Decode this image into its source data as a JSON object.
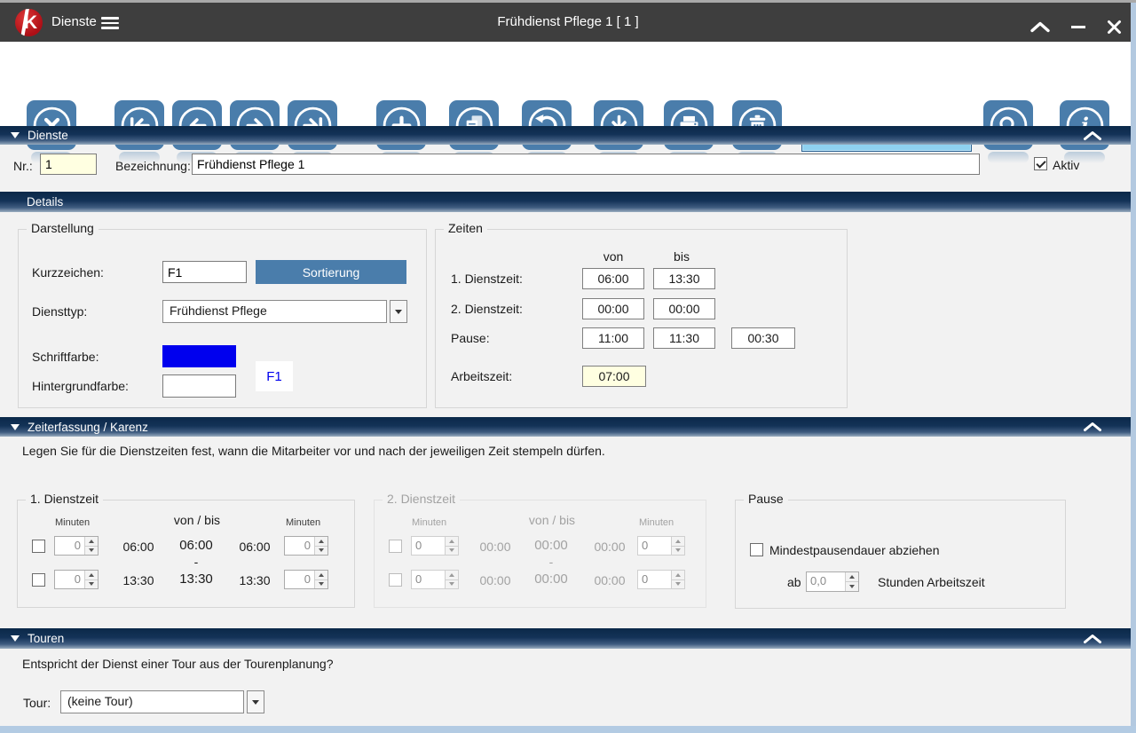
{
  "window": {
    "logo_letter": "K",
    "menu_label": "Dienste",
    "title": "Frühdienst Pflege 1  [ 1 ]"
  },
  "toolbar": {
    "search_value": "",
    "button_names": [
      "close",
      "first-record",
      "previous-record",
      "next-record",
      "last-record",
      "new-record",
      "copy-record",
      "undo",
      "save",
      "print",
      "delete",
      "search",
      "info"
    ]
  },
  "dienste": {
    "header": "Dienste",
    "nr_label": "Nr.:",
    "nr_value": "1",
    "bezeichnung_label": "Bezeichnung:",
    "bezeichnung_value": "Frühdienst Pflege 1",
    "aktiv_label": "Aktiv",
    "aktiv_checked": true
  },
  "details": {
    "header": "Details",
    "darstellung": {
      "title": "Darstellung",
      "kurzzeichen_label": "Kurzzeichen:",
      "kurzzeichen_value": "F1",
      "sortierung_button": "Sortierung",
      "diensttyp_label": "Diensttyp:",
      "diensttyp_value": "Frühdienst Pflege",
      "schriftfarbe_label": "Schriftfarbe:",
      "schriftfarbe_color": "#0000ee",
      "hintergrundfarbe_label": "Hintergrundfarbe:",
      "hintergrundfarbe_color": "#ffffff",
      "preview_text": "F1"
    },
    "zeiten": {
      "title": "Zeiten",
      "von_label": "von",
      "bis_label": "bis",
      "dienstzeit1_label": "1. Dienstzeit:",
      "dienstzeit1_von": "06:00",
      "dienstzeit1_bis": "13:30",
      "dienstzeit2_label": "2. Dienstzeit:",
      "dienstzeit2_von": "00:00",
      "dienstzeit2_bis": "00:00",
      "pause_label": "Pause:",
      "pause_von": "11:00",
      "pause_bis": "11:30",
      "pause_dauer": "00:30",
      "arbeitszeit_label": "Arbeitszeit:",
      "arbeitszeit_value": "07:00"
    }
  },
  "zeiterfassung": {
    "header": "Zeiterfassung / Karenz",
    "description": "Legen Sie für die Dienstzeiten fest, wann die Mitarbeiter vor und nach der jeweiligen Zeit stempeln dürfen.",
    "dienstzeit1": {
      "title": "1. Dienstzeit",
      "minuten_label": "Minuten",
      "vonbis_label": "von / bis",
      "trenner": "-",
      "row1": {
        "checked": false,
        "minuten_vor": "0",
        "zeit": "06:00",
        "zeit_mitte": "06:00",
        "zeit2": "06:00",
        "minuten_nach": "0"
      },
      "row2": {
        "checked": false,
        "minuten_vor": "0",
        "zeit": "13:30",
        "zeit_mitte": "13:30",
        "zeit2": "13:30",
        "minuten_nach": "0"
      }
    },
    "dienstzeit2": {
      "title": "2. Dienstzeit",
      "minuten_label": "Minuten",
      "vonbis_label": "von / bis",
      "trenner": "-",
      "row1": {
        "checked": false,
        "minuten_vor": "0",
        "zeit": "00:00",
        "zeit_mitte": "00:00",
        "zeit2": "00:00",
        "minuten_nach": "0"
      },
      "row2": {
        "checked": false,
        "minuten_vor": "0",
        "zeit": "00:00",
        "zeit_mitte": "00:00",
        "zeit2": "00:00",
        "minuten_nach": "0"
      }
    },
    "pause": {
      "title": "Pause",
      "checkbox_label": "Mindestpausendauer abziehen",
      "checkbox_checked": false,
      "ab_label": "ab",
      "ab_value": "0,0",
      "suffix_label": "Stunden Arbeitszeit"
    }
  },
  "touren": {
    "header": "Touren",
    "question": "Entspricht der Dienst einer Tour aus der Tourenplanung?",
    "tour_label": "Tour:",
    "tour_value": "(keine Tour)"
  },
  "colors": {
    "accent": "#4a7dab",
    "header_dark": "#0b2949",
    "titlebar": "#3e3e3e",
    "field_yellow": "#ffffe1",
    "search_field": "#8ed1f0",
    "logo_red": "#b5121b",
    "schriftfarbe": "#0000ee"
  }
}
